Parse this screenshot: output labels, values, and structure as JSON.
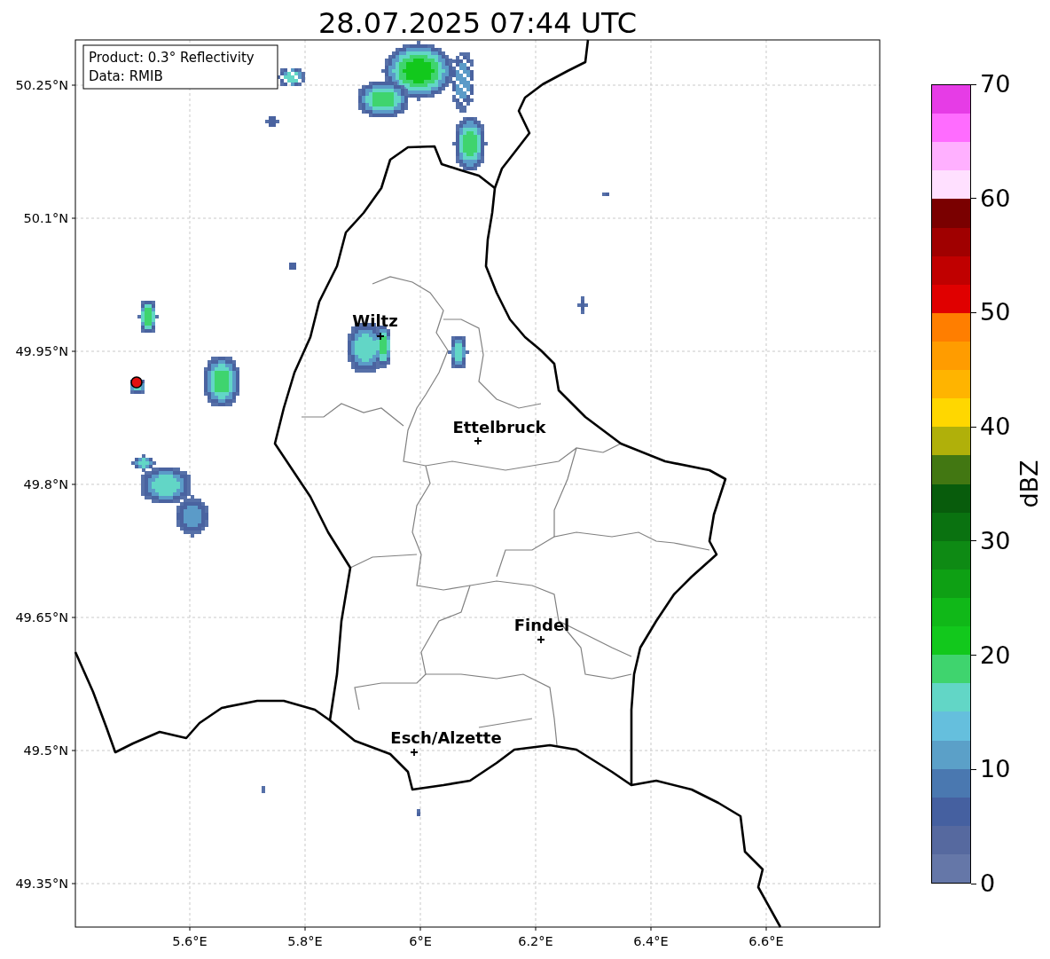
{
  "title": "28.07.2025 07:44 UTC",
  "info_box": [
    "Product: 0.3° Reflectivity",
    "Data: RMIB"
  ],
  "cities": [
    "Wiltz",
    "Ettelbruck",
    "Findel",
    "Esch/Alzette"
  ],
  "latitude_labels": [
    "50.25°N",
    "50.1°N",
    "49.95°N",
    "49.8°N",
    "49.65°N",
    "49.5°N",
    "49.35°N"
  ],
  "longitude_labels": [
    "5.6°E",
    "5.8°E",
    "6°E",
    "6.2°E",
    "6.4°E",
    "6.6°E"
  ],
  "colorbar": {
    "label": "dBZ",
    "ticks": [
      "70",
      "60",
      "50",
      "40",
      "30",
      "20",
      "10",
      "0"
    ],
    "segments": [
      {
        "color": "#e63ce6"
      },
      {
        "color": "#ff6cff"
      },
      {
        "color": "#ffb0ff"
      },
      {
        "color": "#ffe0ff"
      },
      {
        "color": "#7a0000"
      },
      {
        "color": "#a00000"
      },
      {
        "color": "#c00000"
      },
      {
        "color": "#e00000"
      },
      {
        "color": "#ff7e00"
      },
      {
        "color": "#ff9c00"
      },
      {
        "color": "#ffb400"
      },
      {
        "color": "#ffd700"
      },
      {
        "color": "#b0b00a"
      },
      {
        "color": "#427712"
      },
      {
        "color": "#085c0c"
      },
      {
        "color": "#0a7210"
      },
      {
        "color": "#0e8a14"
      },
      {
        "color": "#0ea014"
      },
      {
        "color": "#10b818"
      },
      {
        "color": "#12c81c"
      },
      {
        "color": "#3fd46e"
      },
      {
        "color": "#62d6c6"
      },
      {
        "color": "#65bfdd"
      },
      {
        "color": "#5ba0c8"
      },
      {
        "color": "#4a78b0"
      },
      {
        "color": "#4560a0"
      },
      {
        "color": "#56699f"
      },
      {
        "color": "#6577a8"
      }
    ]
  }
}
